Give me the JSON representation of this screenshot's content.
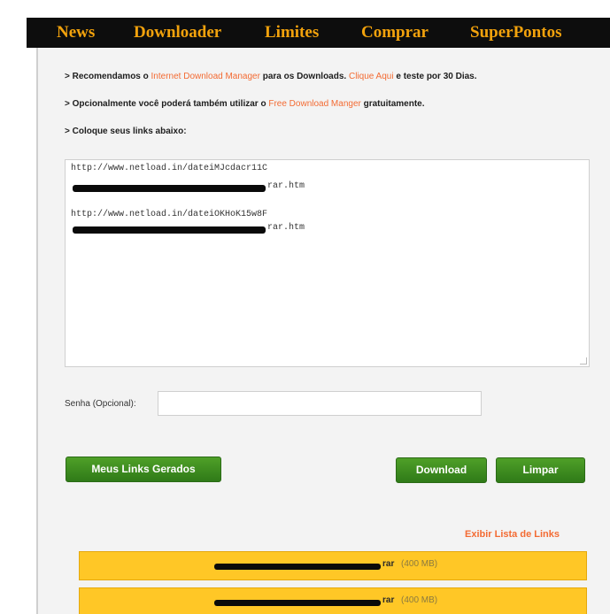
{
  "nav": {
    "items": [
      "News",
      "Downloader",
      "Limites",
      "Comprar",
      "SuperPontos"
    ],
    "accent": "#f2a20c"
  },
  "info": {
    "line1": {
      "prefix": "> Recomendamos o ",
      "link1": "Internet Download Manager",
      "middle": " para os Downloads. ",
      "link2": "Clique Aqui",
      "suffix": " e teste por 30 Dias."
    },
    "line2": {
      "prefix": "> Opcionalmente você poderá também utilizar o ",
      "link": "Free Download Manger",
      "suffix": " gratuitamente."
    },
    "line3": "> Coloque seus links abaixo:"
  },
  "links": [
    {
      "url": "http://www.netload.in/dateiMJcdacr11C",
      "tail": "rar.htm"
    },
    {
      "url": "http://www.netload.in/dateiOKHoK15w8F",
      "tail": "rar.htm"
    }
  ],
  "password": {
    "label": "Senha (Opcional):",
    "value": ""
  },
  "buttons": {
    "meus_links": "Meus Links Gerados",
    "download": "Download",
    "limpar": "Limpar"
  },
  "exibir_lista": "Exibir Lista de Links",
  "results": [
    {
      "ext": "rar",
      "size": "(400 MB)"
    },
    {
      "ext": "rar",
      "size": "(400 MB)"
    }
  ]
}
